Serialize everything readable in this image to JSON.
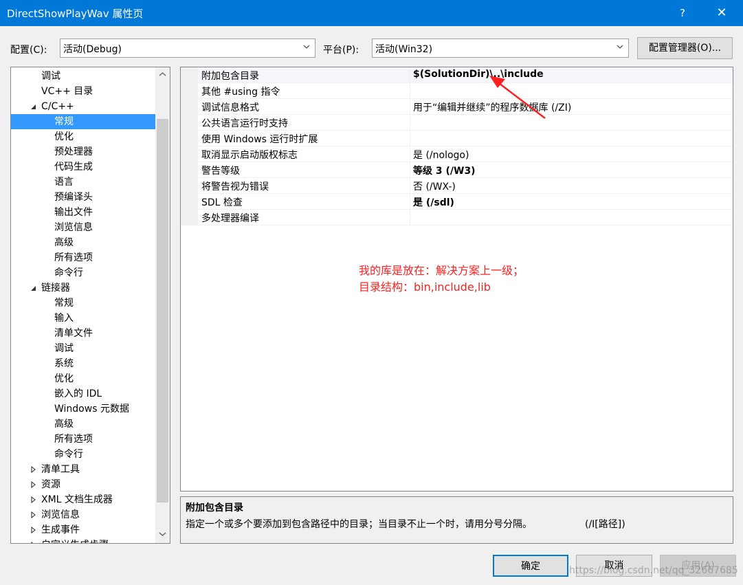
{
  "window": {
    "title": "DirectShowPlayWav 属性页",
    "help": "?",
    "close": "✕"
  },
  "toolbar": {
    "config_label": "配置(C):",
    "config_value": "活动(Debug)",
    "platform_label": "平台(P):",
    "platform_value": "活动(Win32)",
    "manager_button": "配置管理器(O)..."
  },
  "tree": {
    "items": [
      {
        "label": "调试",
        "expander": ""
      },
      {
        "label": "VC++ 目录",
        "expander": ""
      },
      {
        "label": "C/C++",
        "expander": "expanded"
      },
      {
        "label": "常规",
        "expander": "",
        "selected": true
      },
      {
        "label": "优化",
        "expander": ""
      },
      {
        "label": "预处理器",
        "expander": ""
      },
      {
        "label": "代码生成",
        "expander": ""
      },
      {
        "label": "语言",
        "expander": ""
      },
      {
        "label": "预编译头",
        "expander": ""
      },
      {
        "label": "输出文件",
        "expander": ""
      },
      {
        "label": "浏览信息",
        "expander": ""
      },
      {
        "label": "高级",
        "expander": ""
      },
      {
        "label": "所有选项",
        "expander": ""
      },
      {
        "label": "命令行",
        "expander": ""
      },
      {
        "label": "链接器",
        "expander": "expanded"
      },
      {
        "label": "常规",
        "expander": ""
      },
      {
        "label": "输入",
        "expander": ""
      },
      {
        "label": "清单文件",
        "expander": ""
      },
      {
        "label": "调试",
        "expander": ""
      },
      {
        "label": "系统",
        "expander": ""
      },
      {
        "label": "优化",
        "expander": ""
      },
      {
        "label": "嵌入的 IDL",
        "expander": ""
      },
      {
        "label": "Windows 元数据",
        "expander": ""
      },
      {
        "label": "高级",
        "expander": ""
      },
      {
        "label": "所有选项",
        "expander": ""
      },
      {
        "label": "命令行",
        "expander": ""
      },
      {
        "label": "清单工具",
        "expander": "collapsed"
      },
      {
        "label": "资源",
        "expander": "collapsed"
      },
      {
        "label": "XML 文档生成器",
        "expander": "collapsed"
      },
      {
        "label": "浏览信息",
        "expander": "collapsed"
      },
      {
        "label": "生成事件",
        "expander": "collapsed"
      },
      {
        "label": "自定义生成步骤",
        "expander": "collapsed"
      }
    ]
  },
  "properties": [
    {
      "name": "附加包含目录",
      "value": "$(SolutionDir)\\..\\include",
      "bold": true
    },
    {
      "name": "其他 #using 指令",
      "value": "",
      "bold": false
    },
    {
      "name": "调试信息格式",
      "value": "用于“编辑并继续”的程序数据库 (/ZI)",
      "bold": false
    },
    {
      "name": "公共语言运行时支持",
      "value": "",
      "bold": false
    },
    {
      "name": "使用 Windows 运行时扩展",
      "value": "",
      "bold": false
    },
    {
      "name": "取消显示启动版权标志",
      "value": "是 (/nologo)",
      "bold": false
    },
    {
      "name": "警告等级",
      "value": "等级 3 (/W3)",
      "bold": true
    },
    {
      "name": "将警告视为错误",
      "value": "否 (/WX-)",
      "bold": false
    },
    {
      "name": "SDL 检查",
      "value": "是 (/sdl)",
      "bold": true
    },
    {
      "name": "多处理器编译",
      "value": "",
      "bold": false
    }
  ],
  "annotation": {
    "line1": "我的库是放在：解决方案上一级；",
    "line2": "目录结构：bin,include,lib",
    "color": "#ff2020"
  },
  "description": {
    "title": "附加包含目录",
    "text": "指定一个或多个要添加到包含路径中的目录；当目录不止一个时，请用分号分隔。",
    "switch": "(/I[路径])"
  },
  "buttons": {
    "ok": "确定",
    "cancel": "取消",
    "apply": "应用(A)"
  },
  "watermark": "https://blog.csdn.net/qq_32667685",
  "colors": {
    "titlebar": "#0078d7",
    "selection": "#3399ff"
  }
}
